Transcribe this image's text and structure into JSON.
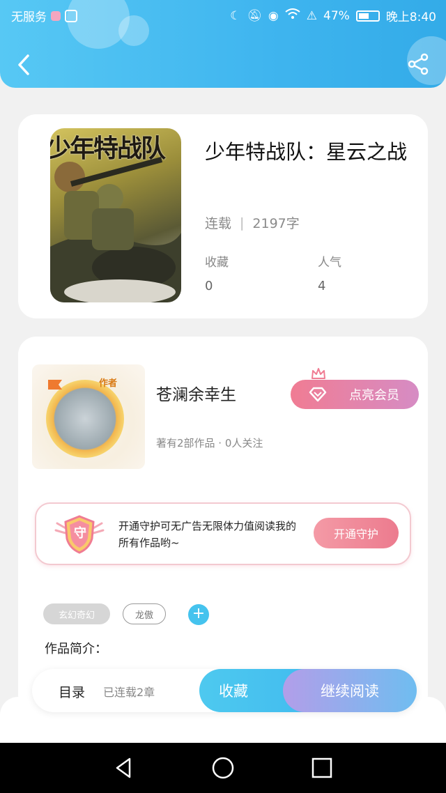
{
  "status_bar": {
    "carrier": "无服务",
    "battery": "47%",
    "time": "晚上8:40"
  },
  "header": {
    "back_icon": "chevron-left-icon",
    "share_icon": "share-icon",
    "background_color": "#3fb5ef"
  },
  "book": {
    "cover_title": "少年特战队",
    "title": "少年特战队：星云之战",
    "status": "连载",
    "word_count": "2197字",
    "stats": [
      {
        "label": "收藏",
        "value": "0"
      },
      {
        "label": "人气",
        "value": "4"
      }
    ]
  },
  "author": {
    "badge": "作者",
    "name": "苍澜余幸生",
    "summary": "著有2部作品 · 0人关注",
    "vip_button": "点亮会员"
  },
  "guard": {
    "badge_char": "守",
    "text": "开通守护可无广告无限体力值阅读我的所有作品哟~",
    "button": "开通守护"
  },
  "tags": [
    "玄幻奇幻",
    "龙傲"
  ],
  "add_tag_symbol": "+",
  "intro_label": "作品简介：",
  "action_bar": {
    "toc_label": "目录",
    "toc_sub": "已连载2章",
    "collect_label": "收藏",
    "read_label": "继续阅读",
    "collect_color": "#45c3ee",
    "read_color": "#b29ee9"
  }
}
